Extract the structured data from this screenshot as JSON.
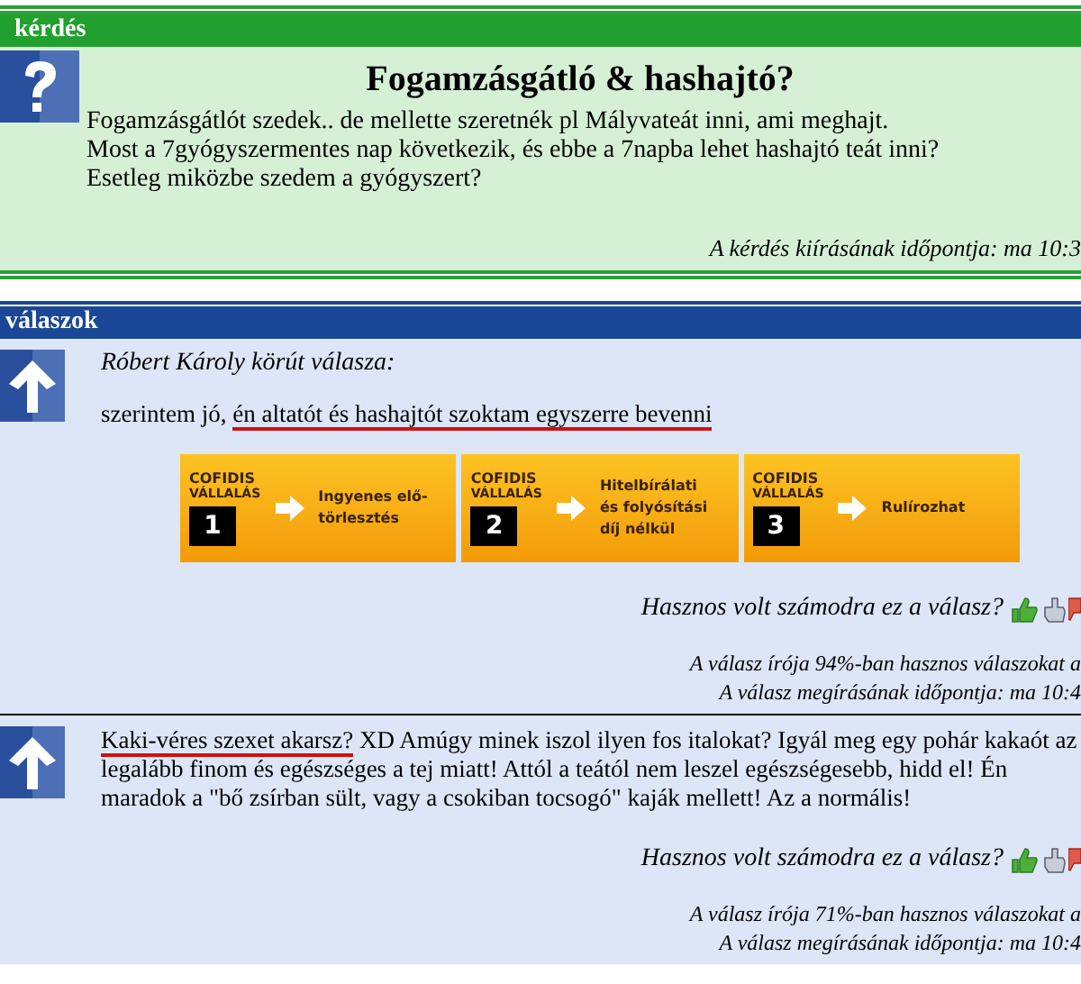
{
  "question": {
    "header": "kérdés",
    "title": "Fogamzásgátló & hashajtó?",
    "body": [
      "Fogamzásgátlót szedek.. de mellette szeretnék pl Mályvateát inni, ami meghajt.",
      "Most a 7gyógyszermentes nap következik, és ebbe a 7napba lehet hashajtó teát inni?",
      "Esetleg miközbe szedem a gyógyszert?"
    ],
    "timestamp": "A kérdés kiírásának időpontja: ma 10:3"
  },
  "answers_header": "válaszok",
  "answers": [
    {
      "author": "Róbert Károly körút válasza:",
      "text_before": "szerintem jó, ",
      "text_marked": "én altatót és hashajtót szoktam egyszerre bevenni",
      "ads": [
        {
          "brand": "COFIDIS",
          "label": "VÁLLALÁS",
          "number": "1",
          "text": "Ingyenes elő- törlesztés"
        },
        {
          "brand": "COFIDIS",
          "label": "VÁLLALÁS",
          "number": "2",
          "text": "Hitelbírálati és folyósítási díj nélkül"
        },
        {
          "brand": "COFIDIS",
          "label": "VÁLLALÁS",
          "number": "3",
          "text": "Rulírozhat"
        }
      ],
      "useful_question": "Hasznos volt számodra ez a válasz?",
      "author_rating": "A válasz írója 94%-ban hasznos válaszokat a",
      "timestamp": "A válasz megírásának időpontja: ma 10:4"
    },
    {
      "text_marked": "Kaki-véres szexet akarsz?",
      "text_after": " XD Amúgy minek iszol ilyen fos italokat? Igyál meg egy pohár kakaót az legalább finom és egészséges a tej miatt! Attól a teától nem leszel egészségesebb, hidd el! Én maradok a \"bő zsírban sült, vagy a csokiban tocsogó\" kaják mellett! Az a normális!",
      "useful_question": "Hasznos volt számodra ez a válasz?",
      "author_rating": "A válasz írója 71%-ban hasznos válaszokat a",
      "timestamp": "A válasz megírásának időpontja: ma 10:4"
    }
  ]
}
